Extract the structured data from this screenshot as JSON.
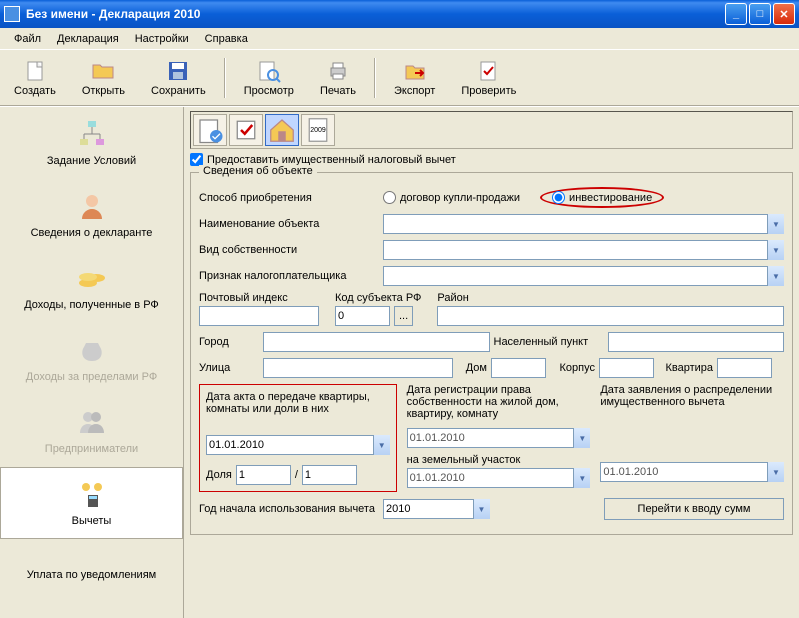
{
  "window": {
    "title": "Без имени - Декларация 2010"
  },
  "menubar": [
    "Файл",
    "Декларация",
    "Настройки",
    "Справка"
  ],
  "toolbar": [
    {
      "id": "create",
      "label": "Создать"
    },
    {
      "id": "open",
      "label": "Открыть"
    },
    {
      "id": "save",
      "label": "Сохранить"
    },
    {
      "id": "preview",
      "label": "Просмотр"
    },
    {
      "id": "print",
      "label": "Печать"
    },
    {
      "id": "export",
      "label": "Экспорт"
    },
    {
      "id": "check",
      "label": "Проверить"
    }
  ],
  "sidebar": [
    {
      "label": "Задание Условий"
    },
    {
      "label": "Сведения о декларанте"
    },
    {
      "label": "Доходы, полученные в РФ"
    },
    {
      "label": "Доходы за пределами РФ",
      "disabled": true
    },
    {
      "label": "Предприниматели",
      "disabled": true
    },
    {
      "label": "Вычеты",
      "selected": true
    },
    {
      "label": "Уплата по уведомлениям"
    }
  ],
  "tab_2009": "2009",
  "checkbox_label": "Предоставить имущественный налоговый вычет",
  "fieldset_legend": "Сведения об объекте",
  "labels": {
    "acq_method": "Способ приобретения",
    "radio_contract": "договор купли-продажи",
    "radio_invest": "инвестирование",
    "object_name": "Наименование объекта",
    "ownership": "Вид собственности",
    "taxpayer_sign": "Признак налогоплательщика",
    "postal": "Почтовый индекс",
    "subject_code": "Код субъекта РФ",
    "region": "Район",
    "city": "Город",
    "settlement": "Населенный пункт",
    "street": "Улица",
    "house": "Дом",
    "building": "Корпус",
    "apartment": "Квартира",
    "date_act": "Дата акта о передаче квартиры, комнаты или доли в них",
    "date_reg": "Дата регистрации права собственности на жилой дом, квартиру, комнату",
    "date_decl": "Дата заявления о распределении имущественного вычета",
    "land_lot": "на земельный участок",
    "share": "Доля",
    "year_start": "Год начала использования вычета",
    "go_sums": "Перейти к вводу сумм"
  },
  "values": {
    "subject_code": "0",
    "date_act": "01.01.2010",
    "date_reg": "01.01.2010",
    "date_land": "01.01.2010",
    "date_decl": "01.01.2010",
    "share_num": "1",
    "share_den": "1",
    "year": "2010",
    "subject_btn": "..."
  }
}
